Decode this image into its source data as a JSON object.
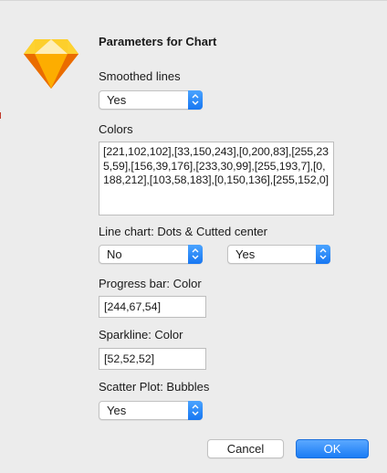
{
  "dialog": {
    "title": "Parameters for Chart",
    "app_icon": "sketch-diamond-icon"
  },
  "fields": {
    "smoothed_lines": {
      "label": "Smoothed lines",
      "value": "Yes"
    },
    "colors": {
      "label": "Colors",
      "value": "[221,102,102],[33,150,243],[0,200,83],[255,235,59],[156,39,176],[233,30,99],[255,193,7],[0,188,212],[103,58,183],[0,150,136],[255,152,0]"
    },
    "line_chart": {
      "label": "Line chart: Dots & Cutted center",
      "dots_value": "No",
      "cutted_center_value": "Yes"
    },
    "progress_bar": {
      "label": "Progress bar: Color",
      "value": "[244,67,54]"
    },
    "sparkline": {
      "label": "Sparkline: Color",
      "value": "[52,52,52]"
    },
    "scatter_plot": {
      "label": "Scatter Plot: Bubbles",
      "value": "Yes"
    }
  },
  "buttons": {
    "cancel_label": "Cancel",
    "ok_label": "OK"
  },
  "colors": {
    "accent": "#1a7cf5",
    "icon_orange": "#f7a623",
    "icon_yellow": "#fdd14b"
  }
}
